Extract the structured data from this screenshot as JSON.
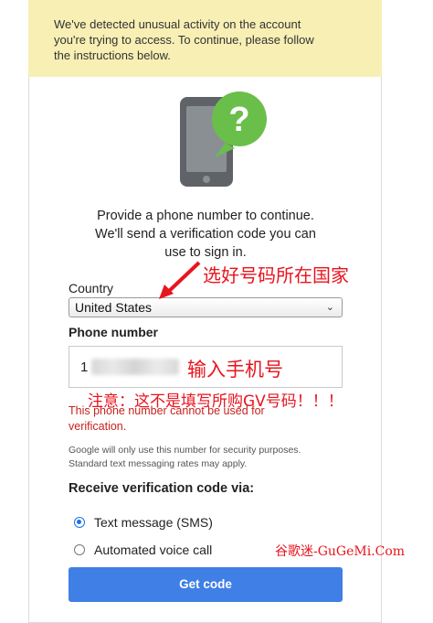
{
  "banner": {
    "line1": "We've detected unusual activity on the account",
    "line2": "you're trying to access. To continue, please follow",
    "line3": "the instructions below."
  },
  "illustration": {
    "icon": "phone-question-icon",
    "mark": "?"
  },
  "intro": {
    "line1": "Provide a phone number to continue.",
    "line2": "We'll send a verification code you can",
    "line3": "use to sign in."
  },
  "country": {
    "label": "Country",
    "selected": "United States"
  },
  "phone": {
    "label": "Phone number",
    "value": "1"
  },
  "error": {
    "line1": "This phone number cannot be used for",
    "line2": "verification."
  },
  "note": {
    "line1": "Google will only use this number for security purposes.",
    "line2": "Standard text messaging rates may apply."
  },
  "receive": {
    "heading": "Receive verification code via:",
    "options": [
      {
        "label": "Text message (SMS)",
        "selected": true
      },
      {
        "label": "Automated voice call",
        "selected": false
      }
    ]
  },
  "submit": {
    "label": "Get code"
  },
  "annotations": {
    "country_hint": "选好号码所在国家",
    "phone_hint": "输入手机号",
    "warning": "注意：这不是填写所购GV号码！！！",
    "watermark": "谷歌迷-GuGeMi.Com"
  },
  "colors": {
    "banner": "#f8efb5",
    "accent": "#3f7fe6",
    "error": "#c5221f",
    "annotation": "#e8141e",
    "illustration_green": "#6abf4b"
  }
}
